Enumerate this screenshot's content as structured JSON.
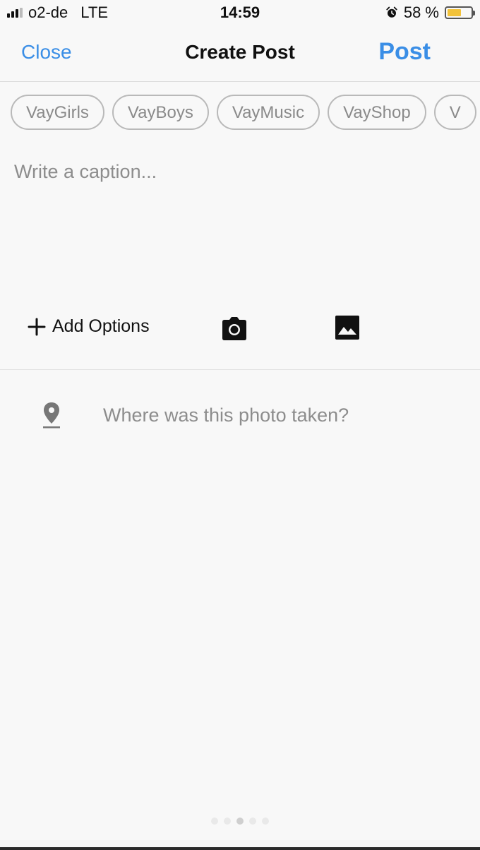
{
  "status_bar": {
    "carrier": "o2-de",
    "network": "LTE",
    "time": "14:59",
    "battery_text": "58 %",
    "battery_level": 0.58,
    "battery_color": "#f2c23a"
  },
  "nav": {
    "close_label": "Close",
    "title": "Create Post",
    "post_label": "Post",
    "accent_color": "#3a8ee6"
  },
  "chips": [
    "VayGirls",
    "VayBoys",
    "VayMusic",
    "VayShop",
    "V"
  ],
  "caption": {
    "placeholder": "Write a caption...",
    "value": ""
  },
  "toolbar": {
    "add_options_label": "Add Options",
    "icons": [
      "plus-icon",
      "camera-icon",
      "image-icon"
    ]
  },
  "location": {
    "placeholder": "Where was this photo taken?",
    "icon": "location-pin-icon"
  },
  "page_indicator": {
    "count": 5,
    "active_index": 2
  }
}
